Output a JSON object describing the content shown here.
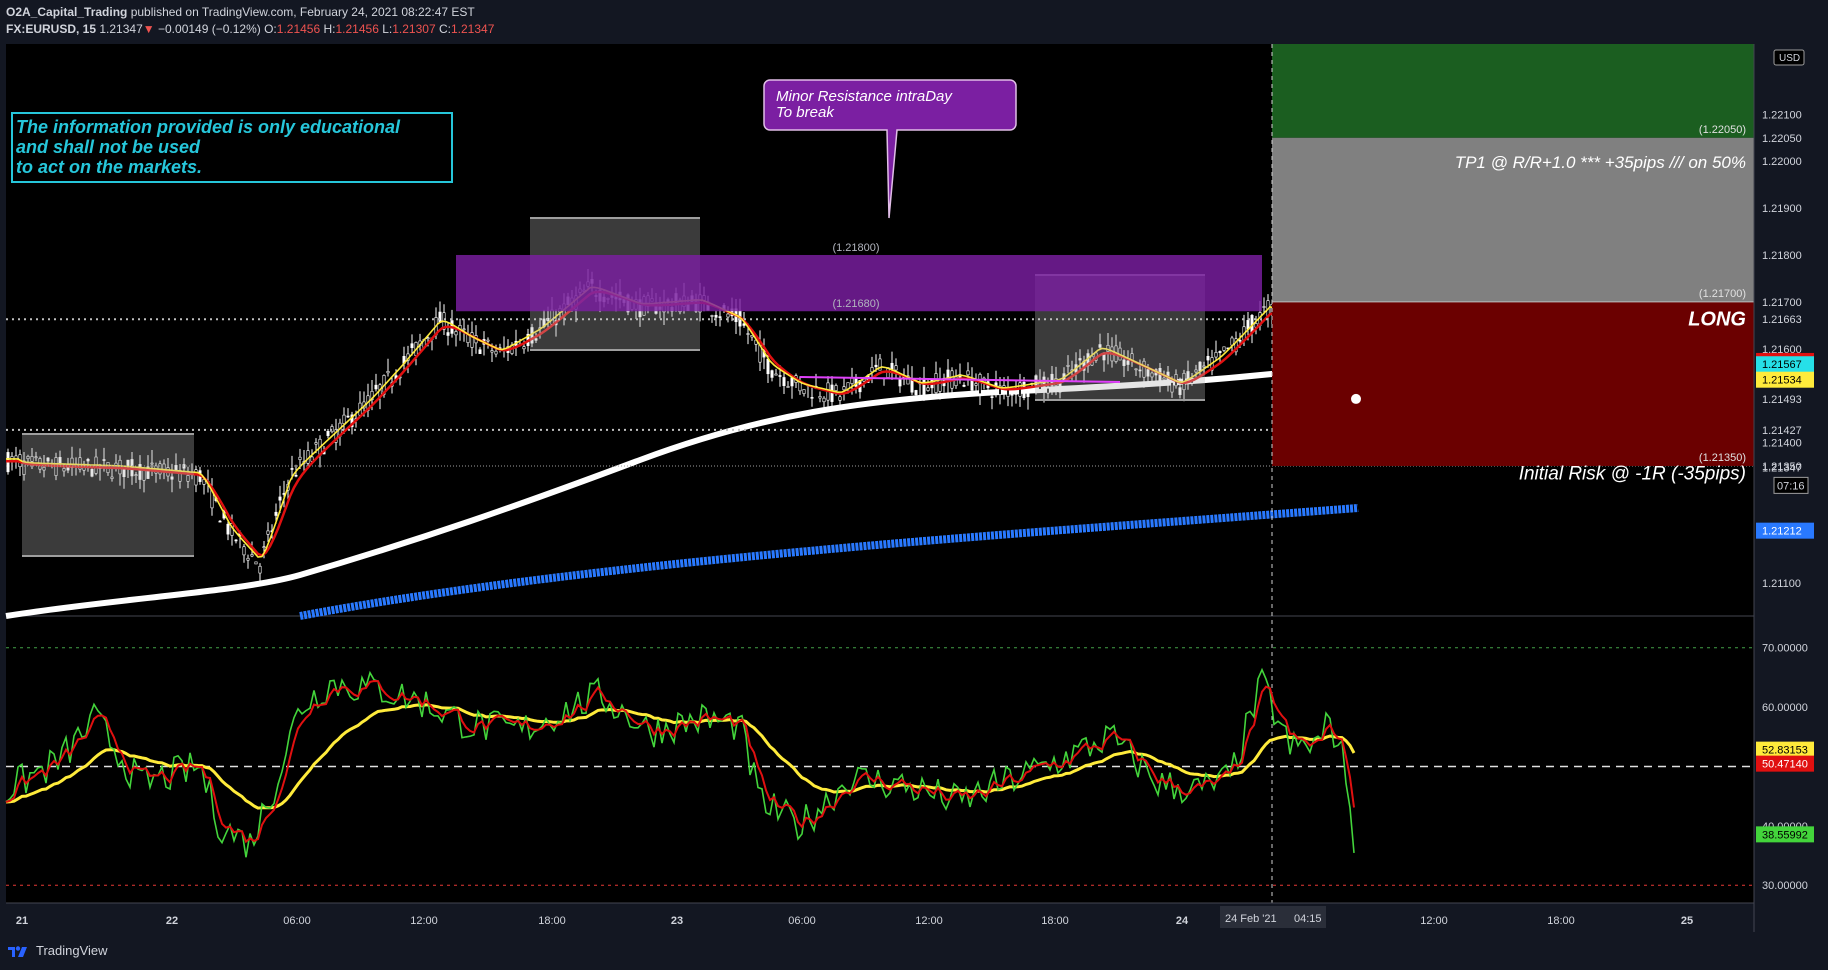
{
  "header": {
    "author": "O2A_Capital_Trading",
    "published": " published on TradingView.com, February 24, 2021 08:22:47 EST",
    "symbol": "FX:EURUSD, 15",
    "last": "1.21347",
    "change": "−0.00149 (−0.12%)",
    "o_label": "O:",
    "o_val": "1.21456",
    "h_label": "H:",
    "h_val": "1.21456",
    "l_label": "L:",
    "l_val": "1.21307",
    "c_label": "C:",
    "c_val": "1.21347"
  },
  "annotations": {
    "disclaimer_1": "The information provided is only educational",
    "disclaimer_2": "and shall not be used",
    "disclaimer_3": "to act on the markets.",
    "callout_1": "Minor Resistance intraDay",
    "callout_2": "To break",
    "tp_text": "TP1 @ R/R+1.0 *** +35pips /// on 50%",
    "long_label": "LONG",
    "risk_text": "Initial Risk @ -1R (-35pips)",
    "zone_top_label": "(1.21800)",
    "zone_bottom_label": "(1.21680)",
    "tp_level_label": "(1.22050)",
    "entry_level_label": "(1.21700)",
    "stop_level_label": "(1.21350)",
    "currency": "USD"
  },
  "crosshair": {
    "date_label": "24 Feb '21",
    "time_label": "04:15"
  },
  "footer": {
    "brand": "TradingView"
  },
  "colors": {
    "background": "#000000",
    "green": "#26a69a",
    "red": "#ef5350",
    "ema_yellow": "#ffeb3b",
    "ema_red": "#e01010",
    "ema_cyan": "#26e0e8",
    "ma_white": "#ffffff",
    "ma_blue": "#2979ff",
    "resistance_zone": "#7b1fa2",
    "tp_zone": "#1b5e20",
    "tp_target": "#808080",
    "risk_zone": "#6b0000",
    "disclaimer": "#26c6da"
  },
  "chart_data": [
    {
      "type": "line",
      "series": [
        {
          "name": "",
          "values_desc": "candles"
        }
      ],
      "ylim": [
        1.2103,
        1.2225
      ],
      "y_ticks": [
        "1.22100",
        "1.22050",
        "1.22000",
        "1.21900",
        "1.21800",
        "1.21700",
        "1.21663",
        "1.21600",
        "1.21574",
        "1.21567",
        "1.21534",
        "1.21493",
        "1.21427",
        "1.21400",
        "1.21350",
        "1.21347",
        "1.21212",
        "1.21100"
      ],
      "y_badges": [
        {
          "label": "1.21574",
          "value": 1.21574,
          "color": "#e01010"
        },
        {
          "label": "1.21567",
          "value": 1.21567,
          "color": "#26e0e8"
        },
        {
          "label": "1.21534",
          "value": 1.21534,
          "color": "#ffeb3b"
        },
        {
          "label": "1.21212",
          "value": 1.21212,
          "color": "#2979ff"
        }
      ],
      "countdown": "07:16",
      "x_ticks": [
        "21",
        "22",
        "06:00",
        "12:00",
        "18:00",
        "23",
        "06:00",
        "12:00",
        "18:00",
        "24",
        "12:00",
        "18:00",
        "25"
      ]
    },
    {
      "type": "line",
      "ylim": [
        27,
        75
      ],
      "y_ticks": [
        "70.00000",
        "60.00000",
        "50.00000",
        "40.00000",
        "30.00000"
      ],
      "y_badges": [
        {
          "label": "52.83153",
          "value": 52.83,
          "color": "#ffeb3b"
        },
        {
          "label": "50.47140",
          "value": 50.47,
          "color": "#e01010"
        },
        {
          "label": "38.55992",
          "value": 38.56,
          "color": "#43d43b"
        }
      ],
      "levels": [
        70,
        50,
        30
      ]
    }
  ]
}
